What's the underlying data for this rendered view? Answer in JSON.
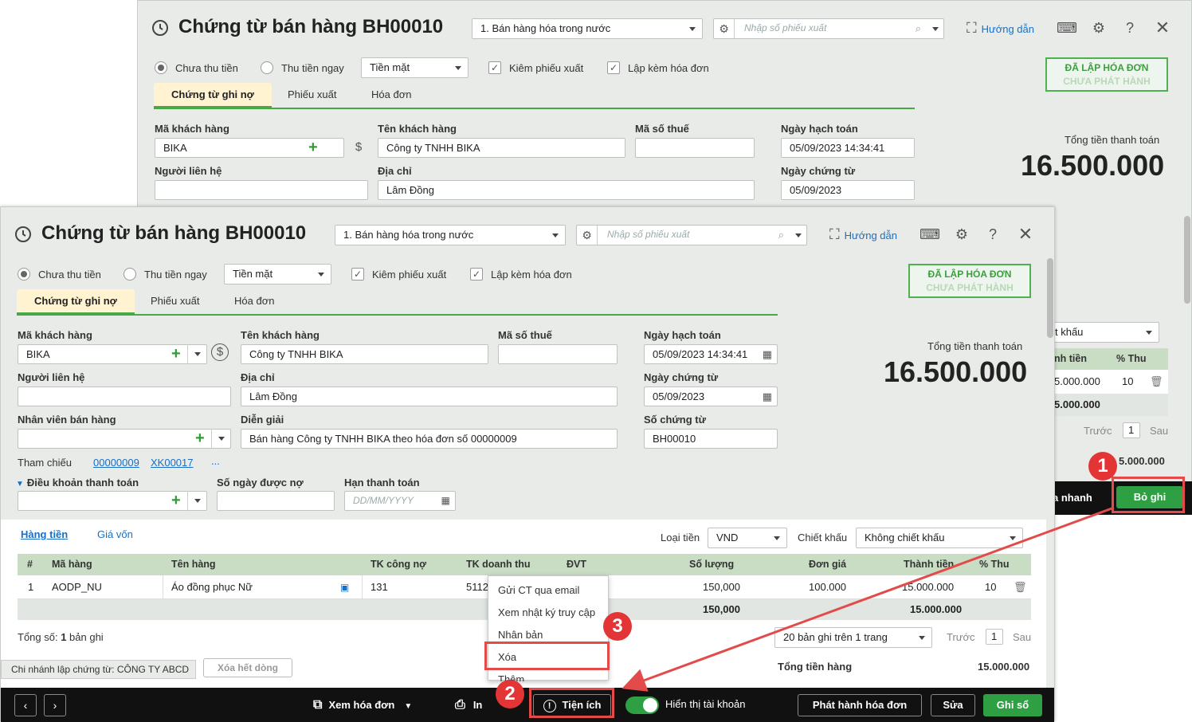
{
  "window": {
    "title": "Chứng từ bán hàng BH00010",
    "sale_type": "1. Bán hàng hóa trong nước",
    "export_search_placeholder": "Nhập số phiếu xuất",
    "guide_link": "Hướng dẫn"
  },
  "payment": {
    "unpaid_label": "Chưa thu tiền",
    "paid_now_label": "Thu tiền ngay",
    "method": "Tiền mặt",
    "with_export_label": "Kiêm phiếu xuất",
    "with_invoice_label": "Lập kèm hóa đơn"
  },
  "stamp": {
    "line1": "ĐÃ LẬP HÓA ĐƠN",
    "line2": "CHƯA PHÁT HÀNH"
  },
  "tabs": [
    "Chứng từ ghi nợ",
    "Phiếu xuất",
    "Hóa đơn"
  ],
  "form": {
    "customer_code_label": "Mã khách hàng",
    "customer_code": "BIKA",
    "customer_name_label": "Tên khách hàng",
    "customer_name": "Công ty TNHH BIKA",
    "tax_code_label": "Mã số thuế",
    "tax_code": "",
    "contact_label": "Người liên hệ",
    "address_label": "Địa chỉ",
    "address": "Lâm Đồng",
    "salesperson_label": "Nhân viên bán hàng",
    "description_label": "Diễn giải",
    "description": "Bán hàng Công ty TNHH BIKA theo hóa đơn số 00000009",
    "posting_date_label": "Ngày hạch toán",
    "posting_date": "05/09/2023 14:34:41",
    "voucher_date_label": "Ngày chứng từ",
    "voucher_date": "05/09/2023",
    "voucher_no_label": "Số chứng từ",
    "voucher_no": "BH00010",
    "reference_label": "Tham chiếu",
    "ref1": "00000009",
    "ref2": "XK00017",
    "ref_more": "...",
    "payment_terms_label": "Điều khoản thanh toán",
    "debt_days_label": "Số ngày được nợ",
    "due_date_label": "Hạn thanh toán",
    "due_date_placeholder": "DD/MM/YYYY"
  },
  "totals": {
    "label": "Tổng tiền thanh toán",
    "amount": "16.500.000"
  },
  "detail": {
    "tab_goods": "Hàng tiền",
    "tab_cost": "Giá vốn",
    "currency_label": "Loại tiền",
    "currency": "VND",
    "discount_label": "Chiết khấu",
    "discount": "Không chiết khấu",
    "columns": [
      "#",
      "Mã hàng",
      "Tên hàng",
      "TK công nợ",
      "TK doanh thu",
      "ĐVT",
      "Số lượng",
      "Đơn giá",
      "Thành tiền",
      "% Thu"
    ],
    "row": {
      "no": "1",
      "code": "AODP_NU",
      "name": "Áo đồng phục Nữ",
      "debt_acc": "131",
      "rev_acc": "5112",
      "qty": "150,000",
      "price": "100.000",
      "amount": "15.000.000",
      "tax": "10"
    },
    "sum_qty": "150,000",
    "sum_amount": "15.000.000",
    "record_count_prefix": "Tổng số: ",
    "record_count": "1",
    "record_count_suffix": " bản ghi",
    "page_size": "20 bản ghi trên 1 trang",
    "prev": "Trước",
    "page": "1",
    "next": "Sau",
    "goods_total_label": "Tổng tiền hàng",
    "goods_total": "15.000.000",
    "branch_info": "Chi nhánh lập chứng từ: CÔNG TY ABCD",
    "clear_rows": "Xóa hết dòng"
  },
  "menu": [
    "Gửi CT qua email",
    "Xem nhật ký truy cập",
    "Nhân bản",
    "Xóa",
    "Thêm"
  ],
  "footer": {
    "view_invoice": "Xem hóa đơn",
    "print": "In",
    "utilities": "Tiện ích",
    "show_account": "Hiển thị tài khoản",
    "issue_invoice": "Phát hành hóa đơn",
    "edit": "Sửa",
    "post": "Ghi sổ"
  },
  "back_footer": {
    "quick_save_partial": "a nhanh",
    "unpost": "Bỏ ghi",
    "discount_partial": "t khấu",
    "amount_col_partial": "nh tiền",
    "tax_col": "% Thu",
    "row_amount_partial": "5.000.000",
    "row_tax": "10",
    "sum_partial": "5.000.000",
    "prev": "Trước",
    "page": "1",
    "next": "Sau",
    "total_partial": "5.000.000"
  },
  "annotations": {
    "step1": "1",
    "step2": "2",
    "step3": "3"
  },
  "colors": {
    "accent_green": "#2ea043",
    "annotation_red": "#e34b4b",
    "link_blue": "#1a6fc4"
  }
}
